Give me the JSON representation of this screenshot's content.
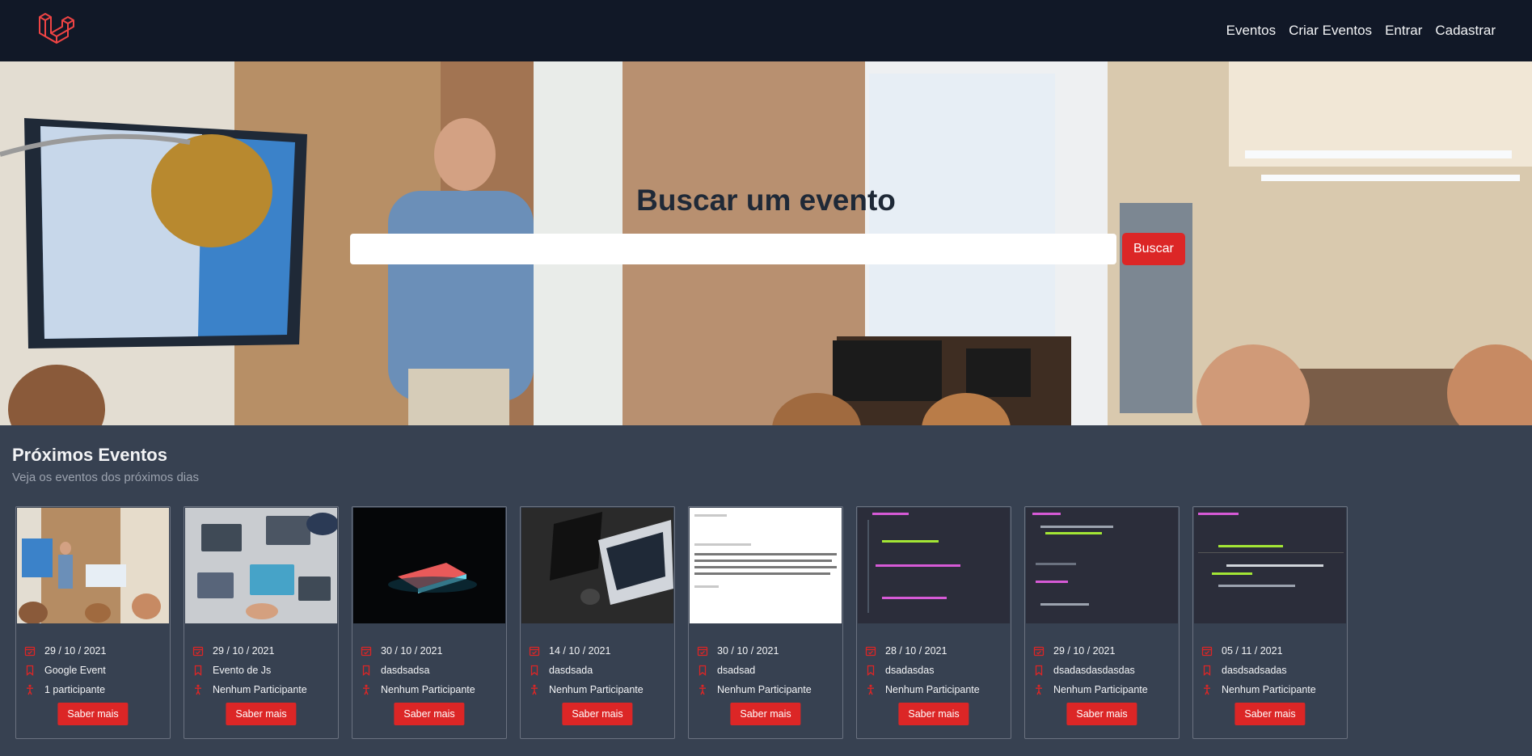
{
  "navbar": {
    "logo_icon": "laravel-logo-icon",
    "links": [
      "Eventos",
      "Criar Eventos",
      "Entrar",
      "Cadastrar"
    ]
  },
  "hero": {
    "title": "Buscar um evento",
    "search_value": "",
    "search_button": "Buscar"
  },
  "events": {
    "title": "Próximos Eventos",
    "subtitle": "Veja os eventos dos próximos dias",
    "button_label": "Saber mais",
    "items": [
      {
        "date": "29 / 10 / 2021",
        "name": "Google Event",
        "participants": "1 participante"
      },
      {
        "date": "29 / 10 / 2021",
        "name": "Evento de Js",
        "participants": "Nenhum Participante"
      },
      {
        "date": "30 / 10 / 2021",
        "name": "dasdsadsa",
        "participants": "Nenhum Participante"
      },
      {
        "date": "14 / 10 / 2021",
        "name": "dasdsada",
        "participants": "Nenhum Participante"
      },
      {
        "date": "30 / 10 / 2021",
        "name": "dsadsad",
        "participants": "Nenhum Participante"
      },
      {
        "date": "28 / 10 / 2021",
        "name": "dsadasdas",
        "participants": "Nenhum Participante"
      },
      {
        "date": "29 / 10 / 2021",
        "name": "dsadasdasdasdas",
        "participants": "Nenhum Participante"
      },
      {
        "date": "05 / 11 / 2021",
        "name": "dasdsadsadas",
        "participants": "Nenhum Participante"
      }
    ]
  },
  "colors": {
    "navbar_bg": "#111827",
    "page_bg": "#374151",
    "accent": "#dc2626"
  }
}
